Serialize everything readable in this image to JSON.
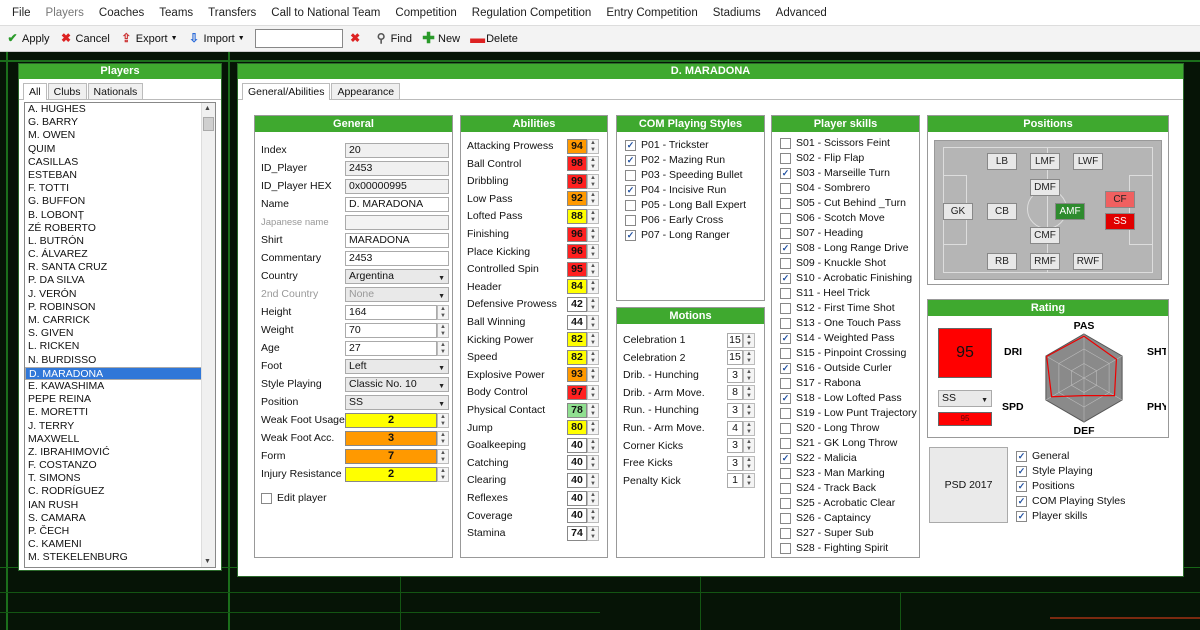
{
  "menu": [
    "File",
    "Players",
    "Coaches",
    "Teams",
    "Transfers",
    "Call to National Team",
    "Competition",
    "Regulation Competition",
    "Entry Competition",
    "Stadiums",
    "Advanced"
  ],
  "toolbar": {
    "apply": "Apply",
    "cancel": "Cancel",
    "export": "Export",
    "import": "Import",
    "search_value": "",
    "find": "Find",
    "new": "New",
    "delete": "Delete"
  },
  "players_window": {
    "title": "Players",
    "tabs": [
      "All",
      "Clubs",
      "Nationals"
    ],
    "players": [
      "A. HUGHES",
      "G. BARRY",
      "M. OWEN",
      "QUIM",
      "CASILLAS",
      "ESTEBAN",
      "F. TOTTI",
      "G. BUFFON",
      "B. LOBONȚ",
      "ZÉ ROBERTO",
      "L. BUTRÓN",
      "C. ÁLVAREZ",
      "R. SANTA CRUZ",
      "P. DA SILVA",
      "J. VERÓN",
      "P. ROBINSON",
      "M. CARRICK",
      "S. GIVEN",
      "L. RICKEN",
      "N. BURDISSO",
      "D. MARADONA",
      "E. KAWASHIMA",
      "PEPE REINA",
      "E. MORETTI",
      "J. TERRY",
      "MAXWELL",
      "Z. IBRAHIMOVIĆ",
      "F. COSTANZO",
      "T. SIMONS",
      "C. RODRÍGUEZ",
      "IAN RUSH",
      "S. CAMARA",
      "P. ČECH",
      "C. KAMENI",
      "M. STEKELENBURG"
    ],
    "selected_index": 20
  },
  "detail": {
    "title": "D. MARADONA",
    "tabs": [
      "General/Abilities",
      "Appearance"
    ]
  },
  "general": {
    "title": "General",
    "index": {
      "label": "Index",
      "value": "20"
    },
    "id_player": {
      "label": "ID_Player",
      "value": "2453"
    },
    "id_player_hex": {
      "label": "ID_Player HEX",
      "value": "0x00000995"
    },
    "name": {
      "label": "Name",
      "value": "D. MARADONA"
    },
    "japanese_name": {
      "label": "Japanese name",
      "value": ""
    },
    "shirt": {
      "label": "Shirt",
      "value": "MARADONA"
    },
    "commentary": {
      "label": "Commentary",
      "value": "2453"
    },
    "country": {
      "label": "Country",
      "value": "Argentina"
    },
    "country2": {
      "label": "2nd Country",
      "value": "None"
    },
    "height": {
      "label": "Height",
      "value": "164"
    },
    "weight": {
      "label": "Weight",
      "value": "70"
    },
    "age": {
      "label": "Age",
      "value": "27"
    },
    "foot": {
      "label": "Foot",
      "value": "Left"
    },
    "style": {
      "label": "Style Playing",
      "value": "Classic No. 10"
    },
    "position": {
      "label": "Position",
      "value": "SS"
    },
    "weak_usage": {
      "label": "Weak Foot Usage",
      "value": "2"
    },
    "weak_acc": {
      "label": "Weak Foot Acc.",
      "value": "3"
    },
    "form": {
      "label": "Form",
      "value": "7"
    },
    "injury": {
      "label": "Injury Resistance",
      "value": "2"
    },
    "edit": "Edit player"
  },
  "abilities": {
    "title": "Abilities",
    "items": [
      {
        "name": "Attacking Prowess",
        "value": "94",
        "color": "#ff9900"
      },
      {
        "name": "Ball Control",
        "value": "98",
        "color": "#ff2020"
      },
      {
        "name": "Dribbling",
        "value": "99",
        "color": "#ff2020"
      },
      {
        "name": "Low Pass",
        "value": "92",
        "color": "#ff9900"
      },
      {
        "name": "Lofted Pass",
        "value": "88",
        "color": "#ffff00"
      },
      {
        "name": "Finishing",
        "value": "96",
        "color": "#ff2020"
      },
      {
        "name": "Place Kicking",
        "value": "96",
        "color": "#ff2020"
      },
      {
        "name": "Controlled Spin",
        "value": "95",
        "color": "#ff2020"
      },
      {
        "name": "Header",
        "value": "84",
        "color": "#ffff00"
      },
      {
        "name": "Defensive Prowess",
        "value": "42",
        "color": "#ffffff"
      },
      {
        "name": "Ball Winning",
        "value": "44",
        "color": "#ffffff"
      },
      {
        "name": "Kicking Power",
        "value": "82",
        "color": "#ffff00"
      },
      {
        "name": "Speed",
        "value": "82",
        "color": "#ffff00"
      },
      {
        "name": "Explosive Power",
        "value": "93",
        "color": "#ff9900"
      },
      {
        "name": "Body Control",
        "value": "97",
        "color": "#ff2020"
      },
      {
        "name": "Physical Contact",
        "value": "78",
        "color": "#90e090"
      },
      {
        "name": "Jump",
        "value": "80",
        "color": "#ffff00"
      },
      {
        "name": "Goalkeeping",
        "value": "40",
        "color": "#ffffff"
      },
      {
        "name": "Catching",
        "value": "40",
        "color": "#ffffff"
      },
      {
        "name": "Clearing",
        "value": "40",
        "color": "#ffffff"
      },
      {
        "name": "Reflexes",
        "value": "40",
        "color": "#ffffff"
      },
      {
        "name": "Coverage",
        "value": "40",
        "color": "#ffffff"
      },
      {
        "name": "Stamina",
        "value": "74",
        "color": "#ffffff"
      }
    ]
  },
  "com_styles": {
    "title": "COM Playing Styles",
    "items": [
      {
        "label": "P01 - Trickster",
        "checked": true
      },
      {
        "label": "P02 - Mazing Run",
        "checked": true
      },
      {
        "label": "P03 - Speeding Bullet",
        "checked": false
      },
      {
        "label": "P04 - Incisive Run",
        "checked": true
      },
      {
        "label": "P05 - Long Ball Expert",
        "checked": false
      },
      {
        "label": "P06 - Early Cross",
        "checked": false
      },
      {
        "label": "P07 - Long Ranger",
        "checked": true
      }
    ]
  },
  "motions": {
    "title": "Motions",
    "items": [
      {
        "name": "Celebration 1",
        "value": "15"
      },
      {
        "name": "Celebration 2",
        "value": "15"
      },
      {
        "name": "Drib. - Hunching",
        "value": "3"
      },
      {
        "name": "Drib. - Arm Move.",
        "value": "8"
      },
      {
        "name": "Run. - Hunching",
        "value": "3"
      },
      {
        "name": "Run. - Arm Move.",
        "value": "4"
      },
      {
        "name": "Corner Kicks",
        "value": "3"
      },
      {
        "name": "Free Kicks",
        "value": "3"
      },
      {
        "name": "Penalty Kick",
        "value": "1"
      }
    ]
  },
  "skills": {
    "title": "Player skills",
    "items": [
      {
        "label": "S01 - Scissors Feint",
        "checked": false
      },
      {
        "label": "S02 - Flip Flap",
        "checked": false
      },
      {
        "label": "S03 - Marseille Turn",
        "checked": true
      },
      {
        "label": "S04 - Sombrero",
        "checked": false
      },
      {
        "label": "S05 - Cut Behind _Turn",
        "checked": false
      },
      {
        "label": "S06 - Scotch Move",
        "checked": false
      },
      {
        "label": "S07 - Heading",
        "checked": false
      },
      {
        "label": "S08 - Long Range Drive",
        "checked": true
      },
      {
        "label": "S09 - Knuckle Shot",
        "checked": false
      },
      {
        "label": "S10 - Acrobatic Finishing",
        "checked": true
      },
      {
        "label": "S11 - Heel Trick",
        "checked": false
      },
      {
        "label": "S12 - First Time Shot",
        "checked": false
      },
      {
        "label": "S13 - One Touch Pass",
        "checked": false
      },
      {
        "label": "S14 - Weighted Pass",
        "checked": true
      },
      {
        "label": "S15 - Pinpoint Crossing",
        "checked": false
      },
      {
        "label": "S16 - Outside Curler",
        "checked": true
      },
      {
        "label": "S17 - Rabona",
        "checked": false
      },
      {
        "label": "S18 - Low Lofted Pass",
        "checked": true
      },
      {
        "label": "S19 - Low Punt Trajectory",
        "checked": false
      },
      {
        "label": "S20 - Long Throw",
        "checked": false
      },
      {
        "label": "S21 - GK Long Throw",
        "checked": false
      },
      {
        "label": "S22 - Malicia",
        "checked": true
      },
      {
        "label": "S23 - Man Marking",
        "checked": false
      },
      {
        "label": "S24 - Track Back",
        "checked": false
      },
      {
        "label": "S25 - Acrobatic Clear",
        "checked": false
      },
      {
        "label": "S26 - Captaincy",
        "checked": false
      },
      {
        "label": "S27 - Super Sub",
        "checked": false
      },
      {
        "label": "S28 - Fighting Spirit",
        "checked": false
      }
    ]
  },
  "positions": {
    "title": "Positions",
    "items": [
      "LB",
      "LMF",
      "LWF",
      "DMF",
      "GK",
      "CB",
      "AMF",
      "CF",
      "SS",
      "CMF",
      "RB",
      "RMF",
      "RWF"
    ]
  },
  "rating": {
    "title": "Rating",
    "value": "95",
    "position": "SS",
    "bar_value": "95",
    "axes": [
      "PAS",
      "SHT",
      "PHY",
      "DEF",
      "SPD",
      "DRI"
    ]
  },
  "export_opts": {
    "button": "PSD 2017",
    "items": [
      {
        "label": "General",
        "checked": true
      },
      {
        "label": "Style Playing",
        "checked": true
      },
      {
        "label": "Positions",
        "checked": true
      },
      {
        "label": "COM Playing Styles",
        "checked": true
      },
      {
        "label": "Player skills",
        "checked": true
      }
    ]
  },
  "colors": {
    "header_green": "#3fa92f",
    "select_blue": "#3077d8"
  }
}
